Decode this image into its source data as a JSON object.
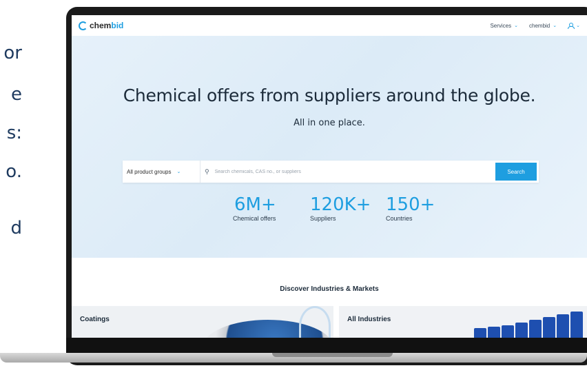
{
  "side_text_fragments": [
    "or",
    "e",
    "s:",
    "o.",
    "d"
  ],
  "nav": {
    "logo": {
      "text_start": "chem",
      "text_accent": "bid",
      "icon": "chembid-logo-icon"
    },
    "items": [
      {
        "label": "Services"
      },
      {
        "label": "chembid"
      }
    ],
    "user_icon": "user-icon"
  },
  "hero": {
    "title": "Chemical offers from suppliers around the globe.",
    "subtitle": "All in one place.",
    "search": {
      "group_label": "All product groups",
      "placeholder": "Search chemicals, CAS no., or suppliers",
      "button": "Search"
    },
    "stats": [
      {
        "value": "6M+",
        "label": "Chemical offers"
      },
      {
        "value": "120K+",
        "label": "Suppliers"
      },
      {
        "value": "150+",
        "label": "Countries"
      }
    ]
  },
  "discover": {
    "title": "Discover Industries & Markets",
    "cards": [
      {
        "label": "Coatings"
      },
      {
        "label": "All Industries"
      }
    ]
  },
  "colors": {
    "accent": "#1e9ee0",
    "text_dark": "#1c2b3a",
    "hero_bg": "#e6f1fa"
  }
}
